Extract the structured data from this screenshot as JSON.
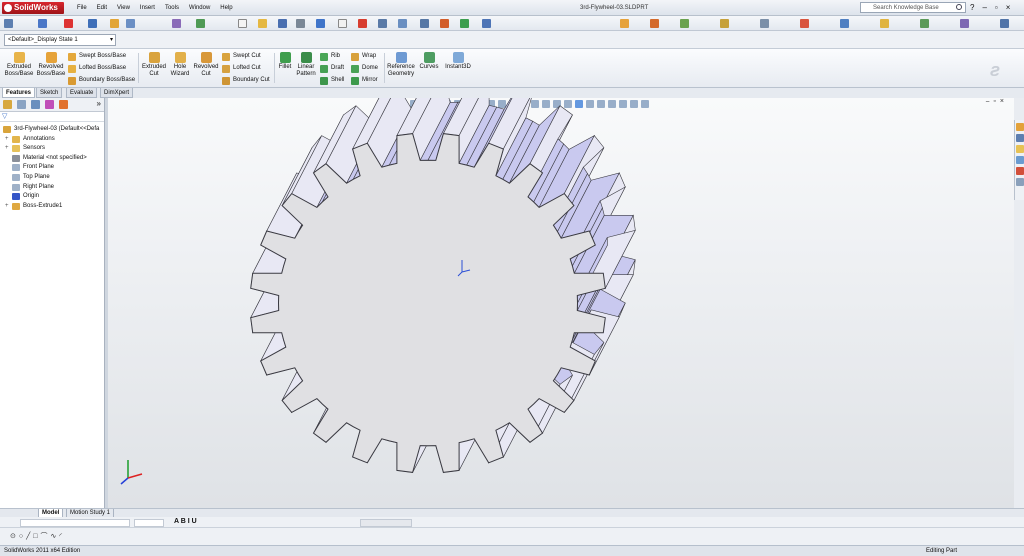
{
  "app": {
    "name": "SolidWorks",
    "document_title": "3rd-Flywheel-03.SLDPRT"
  },
  "menu": [
    "File",
    "Edit",
    "View",
    "Insert",
    "Tools",
    "Window",
    "Help"
  ],
  "search": {
    "placeholder": "Search Knowledge Base"
  },
  "configuration": {
    "selected": "<Default>_Display State 1"
  },
  "command_manager": {
    "extruded_boss": "Extruded\nBoss/Base",
    "revolved_boss": "Revolved\nBoss/Base",
    "swept_boss": "Swept Boss/Base",
    "lofted_boss": "Lofted Boss/Base",
    "boundary_boss": "Boundary Boss/Base",
    "extruded_cut": "Extruded\nCut",
    "hole_wizard": "Hole\nWizard",
    "revolved_cut": "Revolved\nCut",
    "swept_cut": "Swept Cut",
    "lofted_cut": "Lofted Cut",
    "boundary_cut": "Boundary Cut",
    "fillet": "Fillet",
    "linear_pattern": "Linear\nPattern",
    "rib": "Rib",
    "draft": "Draft",
    "shell": "Shell",
    "wrap": "Wrap",
    "dome": "Dome",
    "mirror": "Mirror",
    "reference_geometry": "Reference\nGeometry",
    "curves": "Curves",
    "instant3d": "Instant3D"
  },
  "tabs": [
    "Features",
    "Sketch",
    "Evaluate",
    "DimXpert"
  ],
  "feature_tree": [
    {
      "label": "3rd-Flywheel-03  (Default<<Defa",
      "icon": "part-icon"
    },
    {
      "label": "Annotations",
      "icon": "annotations-icon"
    },
    {
      "label": "Sensors",
      "icon": "sensors-icon"
    },
    {
      "label": "Material <not specified>",
      "icon": "material-icon"
    },
    {
      "label": "Front Plane",
      "icon": "plane-icon"
    },
    {
      "label": "Top Plane",
      "icon": "plane-icon"
    },
    {
      "label": "Right Plane",
      "icon": "plane-icon"
    },
    {
      "label": "Origin",
      "icon": "origin-icon"
    },
    {
      "label": "Boss-Extrude1",
      "icon": "extrude-icon"
    }
  ],
  "model_tabs": [
    "Model",
    "Motion Study 1"
  ],
  "status": {
    "left": "SolidWorks 2011 x64 Edition",
    "right": "Editing Part"
  },
  "colors": {
    "accent": "#3d7fd9",
    "gear_face": "#e0e0e3",
    "gear_flank": "#c9c9ef",
    "logo_red": "#c4161c"
  }
}
